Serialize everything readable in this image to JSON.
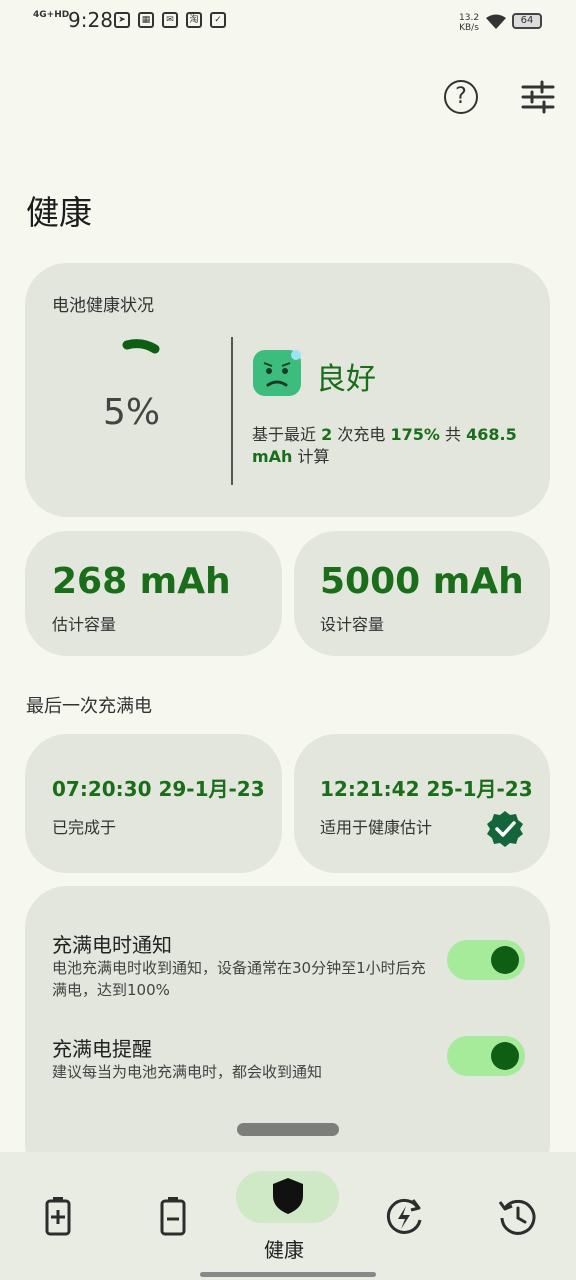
{
  "status_bar": {
    "network": "4G+HD",
    "time": "9:28",
    "speed_value": "13.2",
    "speed_unit": "KB/s",
    "battery": "64"
  },
  "header": {
    "title": "健康"
  },
  "health_card": {
    "label": "电池健康状况",
    "percent": "5%",
    "status": "良好",
    "basis_prefix": "基于最近",
    "charge_count": "2",
    "basis_mid": "次充电",
    "charge_percent": "175%",
    "basis_total": "共",
    "charge_mah": "468.5 mAh",
    "basis_suffix": "计算"
  },
  "capacity": {
    "estimated_value": "268 mAh",
    "estimated_label": "估计容量",
    "design_value": "5000 mAh",
    "design_label": "设计容量"
  },
  "last_full_charge": {
    "section_title": "最后一次充满电",
    "completed_time": "07:20:30 29-1月-23",
    "completed_label": "已完成于",
    "estimate_time": "12:21:42 25-1月-23",
    "estimate_label": "适用于健康估计"
  },
  "settings": {
    "full_charge_notify_title": "充满电时通知",
    "full_charge_notify_desc": "电池充满电时收到通知，设备通常在30分钟至1小时后充满电，达到100%",
    "full_charge_reminder_title": "充满电提醒",
    "full_charge_reminder_desc": "建议每当为电池充满电时，都会收到通知"
  },
  "nav": {
    "active_label": "健康"
  },
  "colors": {
    "accent": "#1a6e1a",
    "card": "#e2e6dc",
    "toggle_track": "#a6eb9a",
    "background": "#f6f8ef"
  }
}
